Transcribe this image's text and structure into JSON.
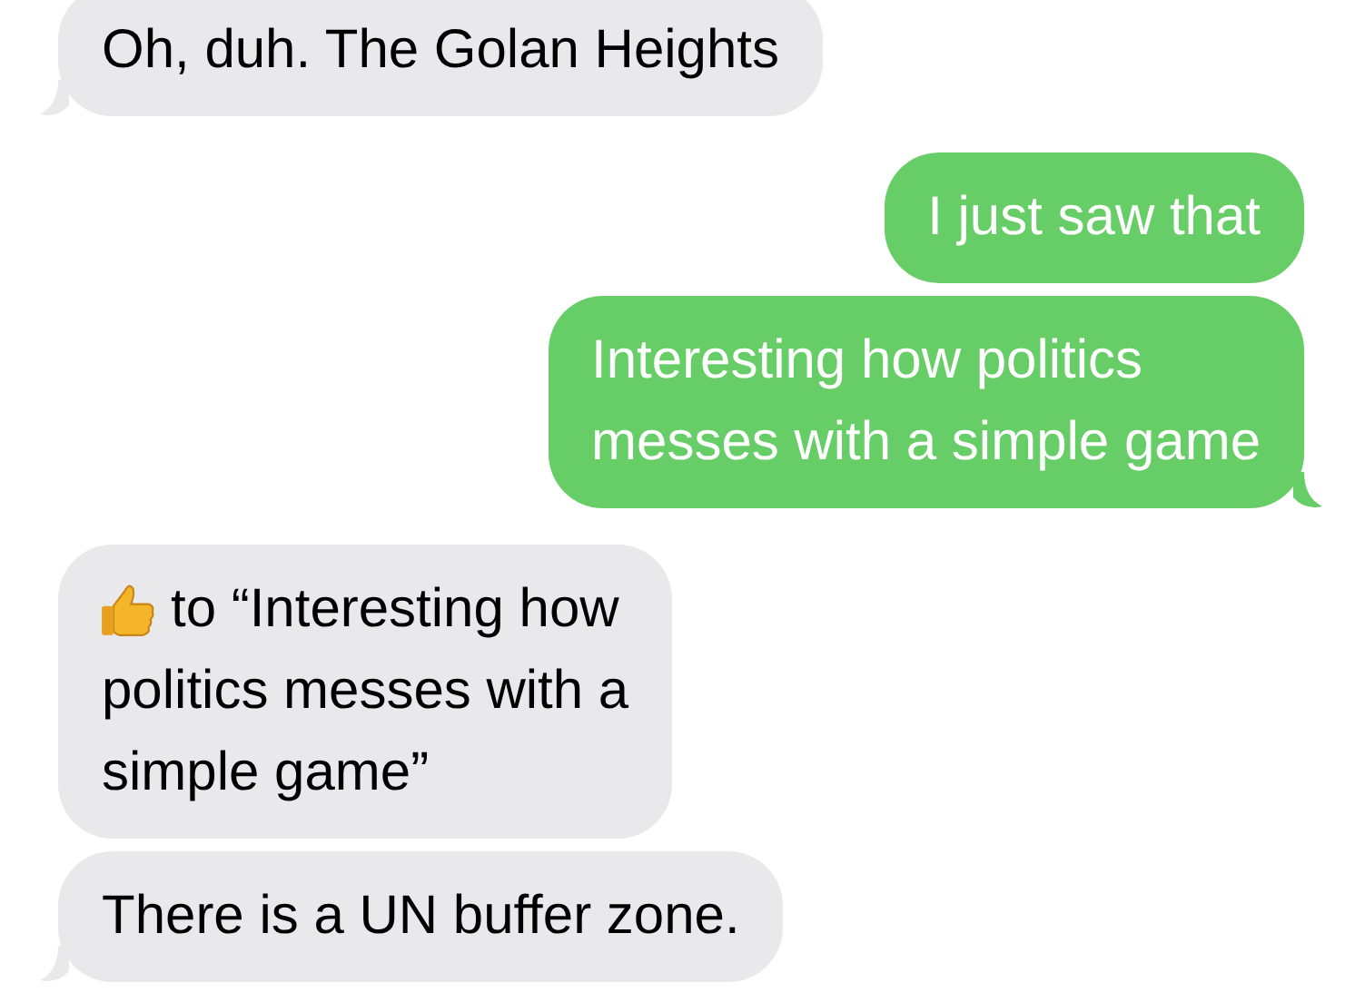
{
  "messages": [
    {
      "outgoing": false,
      "kind": "text",
      "text": "Oh, duh. The Golan Heights",
      "tail": true
    },
    {
      "outgoing": true,
      "kind": "text",
      "text": "I just saw that",
      "tail": false
    },
    {
      "outgoing": true,
      "kind": "text",
      "text": "Interesting how politics\nmesses with a simple game",
      "tail": true
    },
    {
      "outgoing": false,
      "kind": "reaction",
      "lines": [
        "to “Interesting how",
        "politics messes with a",
        "simple game”"
      ],
      "tail": false
    },
    {
      "outgoing": false,
      "kind": "text",
      "text": "There is a UN buffer zone.",
      "tail": true
    }
  ]
}
